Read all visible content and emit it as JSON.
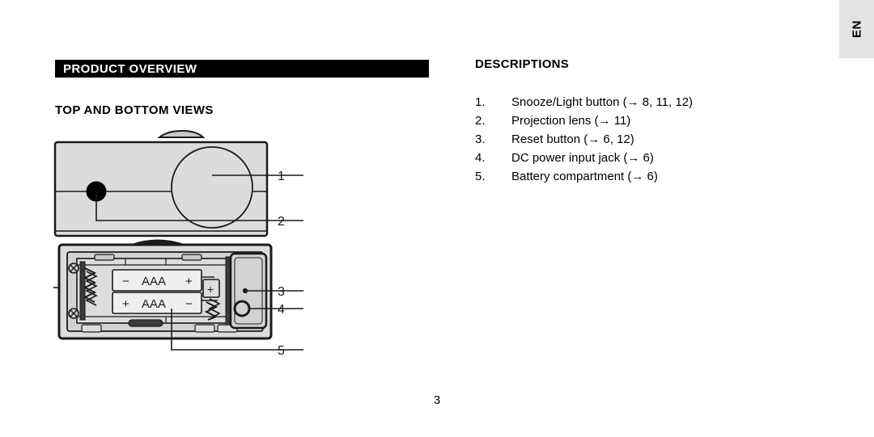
{
  "page": {
    "language_tab": "EN",
    "page_number": "3"
  },
  "section": {
    "title": "PRODUCT OVERVIEW",
    "subtitle": "TOP AND BOTTOM VIEWS"
  },
  "descriptions": {
    "heading": "DESCRIPTIONS",
    "items": [
      {
        "num": "1.",
        "text": "Snooze/Light button (→ 8, 11, 12)"
      },
      {
        "num": "2.",
        "text": "Projection lens (→ 11)"
      },
      {
        "num": "3.",
        "text": "Reset button (→ 6, 12)"
      },
      {
        "num": "4.",
        "text": "DC power input jack (→ 6)"
      },
      {
        "num": "5.",
        "text": "Battery compartment (→ 6)"
      }
    ]
  },
  "figure": {
    "callouts": [
      "1",
      "2",
      "3",
      "4",
      "5"
    ],
    "battery_labels": {
      "top_minus": "−",
      "top_name": "AAA",
      "top_plus": "+",
      "bottom_plus": "+",
      "bottom_name": "AAA",
      "bottom_minus": "−",
      "contact_plus": "+"
    },
    "colors": {
      "body_fill": "#dcdcdc",
      "panel_fill": "#d2d2d2",
      "battery_fill": "#efefef",
      "outline": "#1a1a1a"
    }
  }
}
